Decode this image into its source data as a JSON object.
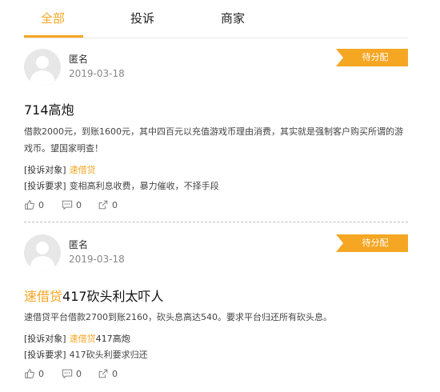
{
  "tabs": [
    {
      "label": "全部",
      "active": true
    },
    {
      "label": "投诉",
      "active": false
    },
    {
      "label": "商家",
      "active": false
    }
  ],
  "accent_color": "#f5a623",
  "posts": [
    {
      "author": "匿名",
      "date": "2019-03-18",
      "status": "待分配",
      "title_prefix": "",
      "title_main": "714高炮",
      "description": "借款2000元，到账1600元，其中四百元以充值游戏币理由消费，其实就是强制客户购买所谓的游戏币。望国家明查！",
      "target_label": "[投诉对象]",
      "target_value": "速借贷",
      "demand_label": "[投诉要求]",
      "demand_value": "变相高利息收费，暴力催收，不择手段",
      "likes": "0",
      "comments": "0",
      "shares": "0"
    },
    {
      "author": "匿名",
      "date": "2019-03-18",
      "status": "待分配",
      "title_prefix": "速借贷",
      "title_main": "417砍头利太吓人",
      "description": "速借贷平台借款2700到账2160，砍头息高达540。要求平台归还所有砍头息。",
      "target_label": "[投诉对象]",
      "target_value_hl": "速借贷",
      "target_value_rest": "417高炮",
      "demand_label": "[投诉要求]",
      "demand_value": "417砍头利要求归还",
      "likes": "0",
      "comments": "0",
      "shares": "0"
    }
  ]
}
